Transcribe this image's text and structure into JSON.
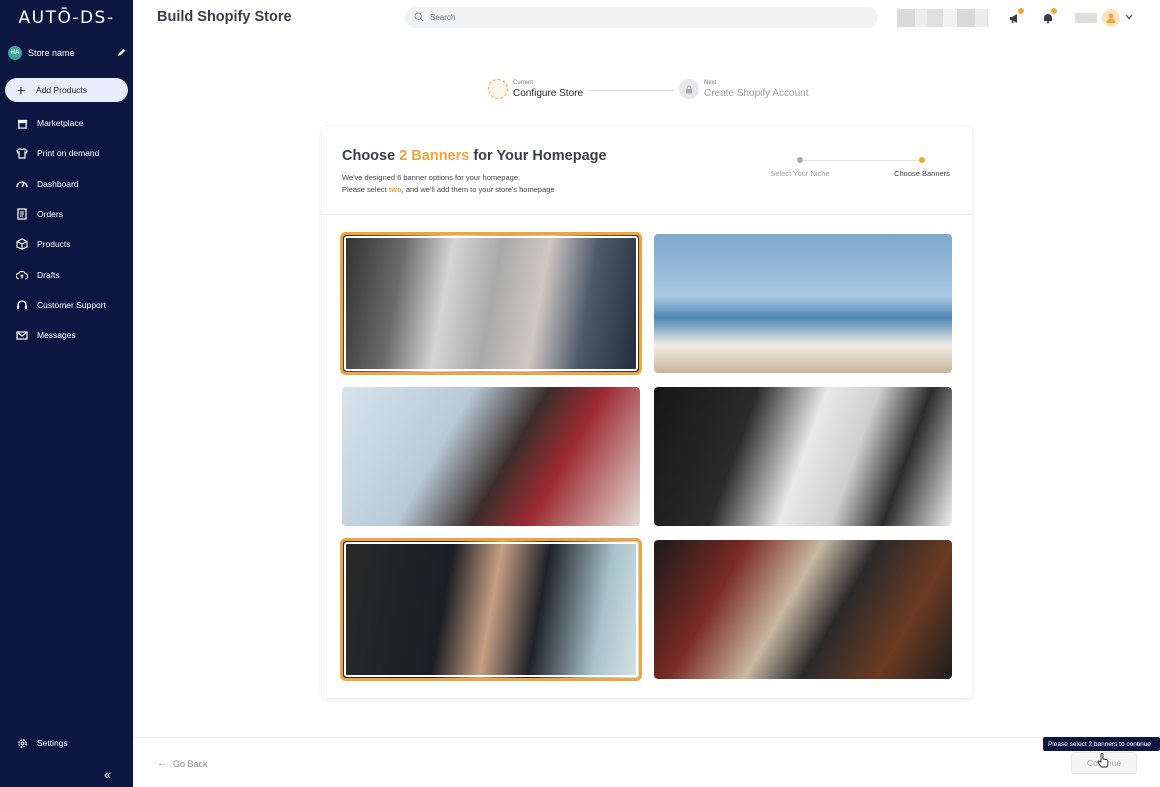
{
  "app": {
    "logo": "AUTŌ-DS-",
    "page_title": "Build Shopify Store"
  },
  "sidebar": {
    "store": {
      "avatar": "HA",
      "name": "Store name"
    },
    "items": [
      {
        "label": "Add Products",
        "icon": "plus-icon",
        "active": true
      },
      {
        "label": "Marketplace",
        "icon": "store-icon"
      },
      {
        "label": "Print on demand",
        "icon": "shirt-icon"
      },
      {
        "label": "Dashboard",
        "icon": "gauge-icon"
      },
      {
        "label": "Orders",
        "icon": "document-icon"
      },
      {
        "label": "Products",
        "icon": "box-icon"
      },
      {
        "label": "Drafts",
        "icon": "cloud-upload-icon"
      },
      {
        "label": "Customer Support",
        "icon": "headset-icon"
      },
      {
        "label": "Messages",
        "icon": "mail-icon"
      }
    ],
    "settings": "Settings",
    "collapse": "«"
  },
  "header": {
    "search_placeholder": "Search"
  },
  "stepper": {
    "current_tag": "Current",
    "current_label": "Configure Store",
    "next_tag": "Next",
    "next_label": "Create Shopify Account"
  },
  "card": {
    "title_prefix": "Choose ",
    "title_accent": "2 Banners",
    "title_suffix": " for Your Homepage",
    "desc_line1": "We've designed 6 banner options for your homepage.",
    "desc_line2_prefix": "Please select ",
    "desc_line2_accent": "two",
    "desc_line2_suffix": ", and we'll add them to your store's homepage",
    "steps": [
      "Select Your Niche",
      "Choose Banners"
    ],
    "banners": [
      {
        "subject": "white handbag and sunglasses",
        "selected": true
      },
      {
        "subject": "floral dress by the sea",
        "selected": false
      },
      {
        "subject": "woman with sunglasses and shopping bags",
        "selected": false
      },
      {
        "subject": "gold earrings and black heels",
        "selected": false
      },
      {
        "subject": "man with wrist watch",
        "selected": true
      },
      {
        "subject": "plaid scarf and brown shoes",
        "selected": false
      }
    ]
  },
  "footer": {
    "go_back": "Go Back",
    "continue": "Continue",
    "tooltip": "Please select 2 banners to continue"
  },
  "colors": {
    "accent": "#f0a43a",
    "sidebar_bg": "#0d1641"
  }
}
